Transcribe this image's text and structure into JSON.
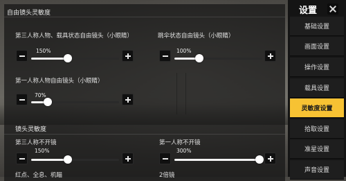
{
  "sidebar": {
    "title": "设置",
    "items": [
      {
        "label": "基础设置",
        "active": false
      },
      {
        "label": "画面设置",
        "active": false
      },
      {
        "label": "操作设置",
        "active": false
      },
      {
        "label": "载具设置",
        "active": false
      },
      {
        "label": "灵敏度设置",
        "active": true
      },
      {
        "label": "拾取设置",
        "active": false
      },
      {
        "label": "准星设置",
        "active": false
      },
      {
        "label": "声音设置",
        "active": false
      }
    ]
  },
  "free_look": {
    "title": "自由镜头灵敏度",
    "third_person_vehicle": {
      "label": "第三人称人物、载具状态自由镜头（小眼睛）",
      "value": "150%",
      "fraction": 0.42
    },
    "parachute": {
      "label": "跳伞状态自由镜头（小眼睛）",
      "value": "100%",
      "fraction": 0.28
    },
    "first_person": {
      "label": "第一人称人物自由镜头（小眼睛）",
      "value": "70%",
      "fraction": 0.19
    }
  },
  "camera": {
    "title": "镜头灵敏度",
    "third_person_no_scope": {
      "label": "第三人称不开镜",
      "value": "150%",
      "fraction": 0.42
    },
    "first_person_no_scope": {
      "label": "第一人称不开镜",
      "value": "300%",
      "fraction": 0.97
    },
    "red_dot_partial": "红点、全息、机瞄",
    "scope_2x_partial": "2倍镜"
  },
  "colors": {
    "accent": "#f7c233",
    "sidebar_bg": "#141414"
  }
}
